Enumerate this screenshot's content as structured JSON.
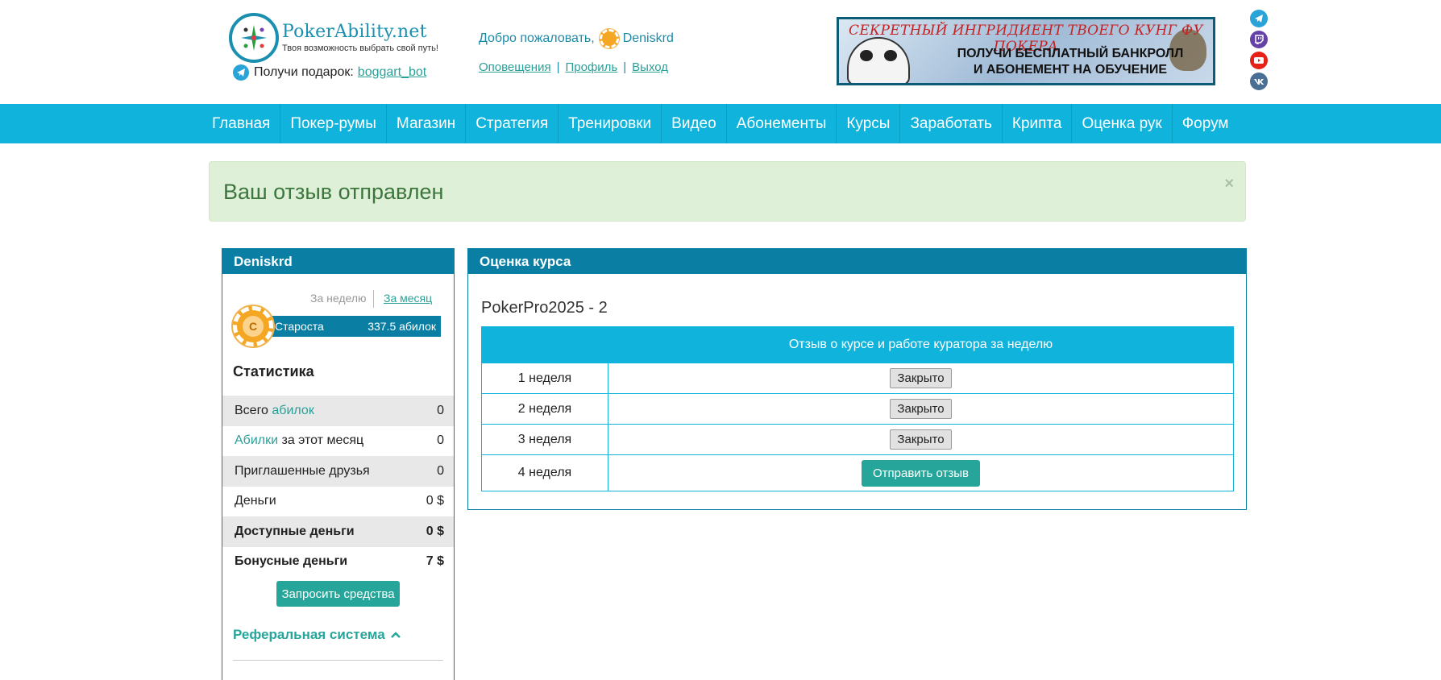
{
  "header": {
    "logo_title": "PokerAbility.net",
    "logo_subtitle": "Твоя возможность выбрать свой путь!",
    "gift_label": "Получи подарок:",
    "gift_link": "boggart_bot",
    "welcome_label": "Добро пожаловать,",
    "username": "Deniskrd",
    "links": [
      "Оповещения",
      "Профиль",
      "Выход"
    ]
  },
  "banner": {
    "top": "СЕКРЕТНЫЙ ИНГРИДИЕНТ ТВОЕГО КУНГ ФУ ПОКЕРА",
    "line1": "ПОЛУЧИ БЕСПЛАТНЫЙ БАНКРОЛЛ",
    "line2": "И АБОНЕМЕНТ НА ОБУЧЕНИЕ"
  },
  "socials": [
    "telegram-icon",
    "twitch-icon",
    "youtube-icon",
    "vk-icon"
  ],
  "nav": [
    "Главная",
    "Покер-румы",
    "Магазин",
    "Стратегия",
    "Тренировки",
    "Видео",
    "Абонементы",
    "Курсы",
    "Заработать",
    "Крипта",
    "Оценка рук",
    "Форум"
  ],
  "alert": {
    "text": "Ваш отзыв отправлен",
    "close": "×"
  },
  "sidebar": {
    "title": "Deniskrd",
    "period_week": "За неделю",
    "period_month": "За месяц",
    "rank_letter": "C",
    "rank_name": "Староста",
    "rank_value": "337.5 абилок",
    "stats_title": "Статистика",
    "stats": [
      {
        "pre": "Всего ",
        "hl": "абилок",
        "post": "",
        "value": "0"
      },
      {
        "pre": "",
        "hl": "Абилки",
        "post": " за этот месяц",
        "value": "0"
      },
      {
        "pre": "Приглашенные друзья",
        "hl": "",
        "post": "",
        "value": "0"
      },
      {
        "pre": "Деньги",
        "hl": "",
        "post": "",
        "value": "0 $"
      },
      {
        "pre": "Доступные деньги",
        "hl": "",
        "post": "",
        "value": "0 $"
      },
      {
        "pre": "Бонусные деньги",
        "hl": "",
        "post": "",
        "value": "7 $"
      }
    ],
    "request_button": "Запросить средства",
    "referral_title": "Реферальная система"
  },
  "course": {
    "panel_title": "Оценка курса",
    "name": "PokerPro2025 - 2",
    "column_header": "Отзыв о курсе и работе куратора за неделю",
    "rows": [
      {
        "week": "1 неделя",
        "action": "Закрыто"
      },
      {
        "week": "2 неделя",
        "action": "Закрыто"
      },
      {
        "week": "3 неделя",
        "action": "Закрыто"
      },
      {
        "week": "4 неделя",
        "action": "Отправить отзыв"
      }
    ]
  },
  "colors": {
    "nav_bg": "#0fb3db",
    "panel_head": "#0a7fa3",
    "accent_green": "#26a69a",
    "alert_bg": "#dff0d8",
    "alert_text": "#3c763d"
  }
}
